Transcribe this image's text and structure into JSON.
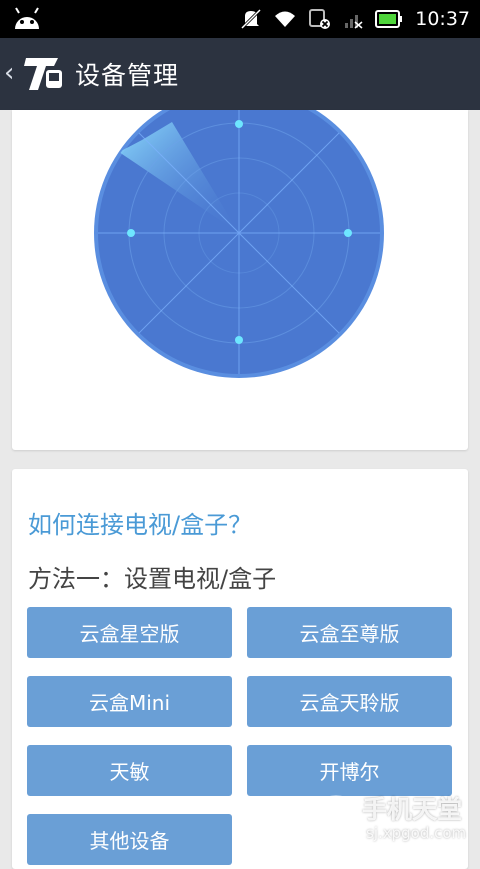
{
  "status_bar": {
    "time": "10:37",
    "icons": [
      "android-icon",
      "mute-icon",
      "wifi-icon",
      "sim-blocked-icon",
      "signal-icon",
      "battery-icon"
    ]
  },
  "app_bar": {
    "title": "设备管理",
    "back_icon": "chevron-left-icon",
    "logo_text": "T"
  },
  "radar": {
    "colors": {
      "fill": "#4a78d0",
      "ring": "#7fb4ff",
      "dot": "#6ee6ff",
      "sweep": "#8fe0ff"
    }
  },
  "help": {
    "title": "如何连接电视/盒子？",
    "method_label": "方法一：设置电视/盒子"
  },
  "devices": [
    "云盒星空版",
    "云盒至尊版",
    "云盒Mini",
    "云盒天聆版",
    "天敏",
    "开博尔",
    "其他设备"
  ],
  "watermark": {
    "main": "手机天堂",
    "sub": "sj.xpgod.com"
  },
  "colors": {
    "button_bg": "#6a9fd6",
    "app_bar_bg": "#2c3340",
    "accent_text": "#4a9ad6"
  }
}
